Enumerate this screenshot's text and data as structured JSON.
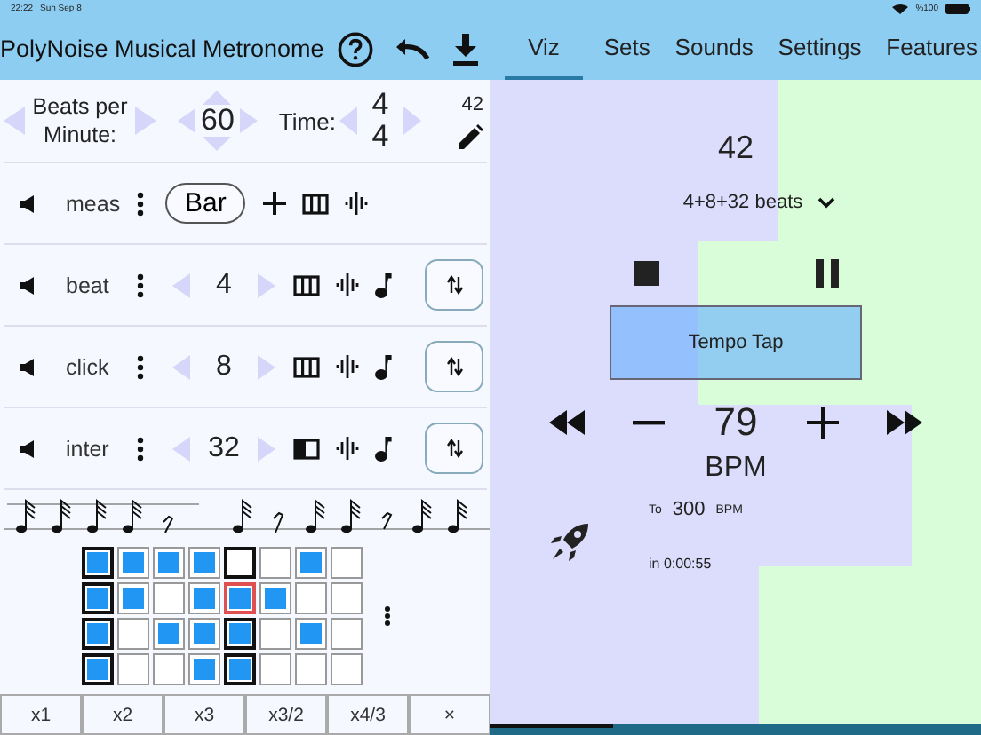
{
  "status_bar": {
    "time": "22:22",
    "date": "Sun Sep 8",
    "battery": "%100"
  },
  "app_title": "PolyNoise Musical Metronome",
  "tabs": [
    {
      "label": "Viz",
      "selected": true
    },
    {
      "label": "Sets",
      "selected": false
    },
    {
      "label": "Sounds",
      "selected": false
    },
    {
      "label": "Settings",
      "selected": false
    },
    {
      "label": "Features",
      "selected": false
    }
  ],
  "tempo_setting": {
    "label": "Beats per Minute:",
    "value": "60"
  },
  "time_signature": {
    "label": "Time:",
    "numerator": "4",
    "denominator": "4"
  },
  "edit_badge": "42",
  "tracks": [
    {
      "kind": "measure",
      "name": "meas",
      "value": "Bar"
    },
    {
      "kind": "pulse",
      "name": "beat",
      "value": "4",
      "half_filled": false
    },
    {
      "kind": "pulse",
      "name": "click",
      "value": "8",
      "half_filled": false
    },
    {
      "kind": "pulse",
      "name": "inter",
      "value": "32",
      "half_filled": true
    }
  ],
  "grid": [
    [
      {
        "on": true,
        "accent": true,
        "current": false
      },
      {
        "on": true,
        "accent": false,
        "current": false
      },
      {
        "on": true,
        "accent": false,
        "current": false
      },
      {
        "on": true,
        "accent": false,
        "current": false
      },
      {
        "on": false,
        "accent": true,
        "current": false
      },
      {
        "on": false,
        "accent": false,
        "current": false
      },
      {
        "on": true,
        "accent": false,
        "current": false
      },
      {
        "on": false,
        "accent": false,
        "current": false
      }
    ],
    [
      {
        "on": true,
        "accent": true,
        "current": false
      },
      {
        "on": true,
        "accent": false,
        "current": false
      },
      {
        "on": false,
        "accent": false,
        "current": false
      },
      {
        "on": true,
        "accent": false,
        "current": false
      },
      {
        "on": true,
        "accent": false,
        "current": true
      },
      {
        "on": true,
        "accent": false,
        "current": false
      },
      {
        "on": false,
        "accent": false,
        "current": false
      },
      {
        "on": false,
        "accent": false,
        "current": false
      }
    ],
    [
      {
        "on": true,
        "accent": true,
        "current": false
      },
      {
        "on": false,
        "accent": false,
        "current": false
      },
      {
        "on": true,
        "accent": false,
        "current": false
      },
      {
        "on": true,
        "accent": false,
        "current": false
      },
      {
        "on": true,
        "accent": true,
        "current": false
      },
      {
        "on": false,
        "accent": false,
        "current": false
      },
      {
        "on": true,
        "accent": false,
        "current": false
      },
      {
        "on": false,
        "accent": false,
        "current": false
      }
    ],
    [
      {
        "on": true,
        "accent": true,
        "current": false
      },
      {
        "on": false,
        "accent": false,
        "current": false
      },
      {
        "on": false,
        "accent": false,
        "current": false
      },
      {
        "on": true,
        "accent": false,
        "current": false
      },
      {
        "on": true,
        "accent": true,
        "current": false
      },
      {
        "on": false,
        "accent": false,
        "current": false
      },
      {
        "on": false,
        "accent": false,
        "current": false
      },
      {
        "on": false,
        "accent": false,
        "current": false
      }
    ]
  ],
  "multipliers": [
    "x1",
    "x2",
    "x3",
    "x3/2",
    "x4/3",
    "×"
  ],
  "viz": {
    "count": "42",
    "beats_selector": "4+8+32 beats",
    "tap_label": "Tempo Tap",
    "tempo": "79",
    "tempo_unit": "BPM",
    "target_prefix": "To",
    "target": "300",
    "target_unit": "BPM",
    "duration": "in 0:00:55"
  }
}
